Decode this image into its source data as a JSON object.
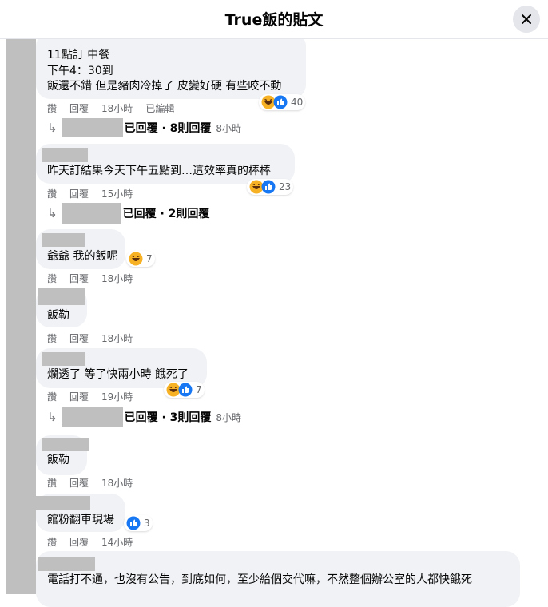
{
  "header": {
    "title": "True飯的貼文"
  },
  "actions": {
    "like": "讚",
    "reply": "回覆"
  },
  "comments": [
    {
      "lines": [
        "11點訂 中餐",
        "下午4：30到",
        "飯還不錯 但是豬肉冷掉了 皮變好硬 有些咬不動"
      ],
      "reaction_count": "40",
      "time": "18小時",
      "edited": "已編輯",
      "replies_text": "已回覆 · 8則回覆",
      "replies_time": "8小時"
    },
    {
      "lines": [
        "昨天訂結果今天下午五點到…這效率真的棒棒"
      ],
      "reaction_count": "23",
      "time": "15小時",
      "replies_text": "已回覆 · 2則回覆"
    },
    {
      "lines": [
        "爺爺 我的飯呢"
      ],
      "reaction_count": "7",
      "time": "18小時"
    },
    {
      "lines": [
        "飯勒"
      ],
      "time": "18小時"
    },
    {
      "lines": [
        "爛透了 等了快兩小時 餓死了"
      ],
      "reaction_count": "7",
      "time": "19小時",
      "replies_text": "已回覆 · 3則回覆",
      "replies_time": "8小時"
    },
    {
      "lines": [
        "飯勒"
      ],
      "time": "18小時"
    },
    {
      "lines": [
        "館粉翻車現場"
      ],
      "reaction_count": "3",
      "time": "14小時"
    },
    {
      "lines": [
        "電話打不通，也沒有公告，到底如何，至少給個交代嘛，不然整個辦公室的人都快餓死"
      ]
    }
  ],
  "colors": {
    "bubble": "#f0f2f5",
    "meta": "#65676b",
    "like_blue": "#1877f2",
    "haha_yellow": "#f7b125",
    "redaction_gray": "#bfbfbf"
  }
}
